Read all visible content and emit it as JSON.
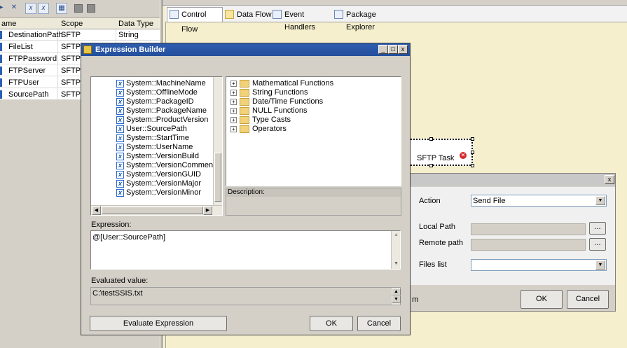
{
  "toolbar": {
    "icons": [
      "add-variable-icon",
      "delete-variable-icon",
      "show-system-variables-icon",
      "show-all-variables-icon",
      "choose-columns-icon",
      "move-variable-icon",
      "options-icon"
    ]
  },
  "variables_grid": {
    "headers": [
      "ame",
      "Scope",
      "Data Type"
    ],
    "rows": [
      {
        "name": "DestinationPath",
        "scope": "SFTP",
        "type": "String"
      },
      {
        "name": "FileList",
        "scope": "SFTP",
        "type": ""
      },
      {
        "name": "FTPPassword",
        "scope": "SFTP",
        "type": ""
      },
      {
        "name": "FTPServer",
        "scope": "SFTP",
        "type": ""
      },
      {
        "name": "FTPUser",
        "scope": "SFTP",
        "type": ""
      },
      {
        "name": "SourcePath",
        "scope": "SFTP",
        "type": ""
      }
    ]
  },
  "designer": {
    "tabs": [
      "Control Flow",
      "Data Flow",
      "Event Handlers",
      "Package Explorer"
    ],
    "task_label": "SFTP Task"
  },
  "sftp_dialog": {
    "action_label": "Action",
    "action_value": "Send File",
    "local_path_label": "Local Path",
    "remote_path_label": "Remote path",
    "files_list_label": "Files list",
    "browse_label": "...",
    "ok_label": "OK",
    "cancel_label": "Cancel",
    "partial_label": "m",
    "close_label": "x"
  },
  "expression_builder": {
    "title": "Expression Builder",
    "variables": [
      "System::MachineName",
      "System::OfflineMode",
      "System::PackageID",
      "System::PackageName",
      "System::ProductVersion",
      "User::SourcePath",
      "System::StartTime",
      "System::UserName",
      "System::VersionBuild",
      "System::VersionComments",
      "System::VersionGUID",
      "System::VersionMajor",
      "System::VersionMinor"
    ],
    "functions": [
      "Mathematical Functions",
      "String Functions",
      "Date/Time Functions",
      "NULL Functions",
      "Type Casts",
      "Operators"
    ],
    "description_label": "Description:",
    "expression_label": "Expression:",
    "expression_value": "@[User::SourcePath]",
    "evaluated_label": "Evaluated value:",
    "evaluated_value": "C:\\testSSIS.txt",
    "evaluate_button": "Evaluate Expression",
    "ok_label": "OK",
    "cancel_label": "Cancel",
    "minimize_label": "_",
    "maximize_label": "□",
    "close_label": "x"
  }
}
